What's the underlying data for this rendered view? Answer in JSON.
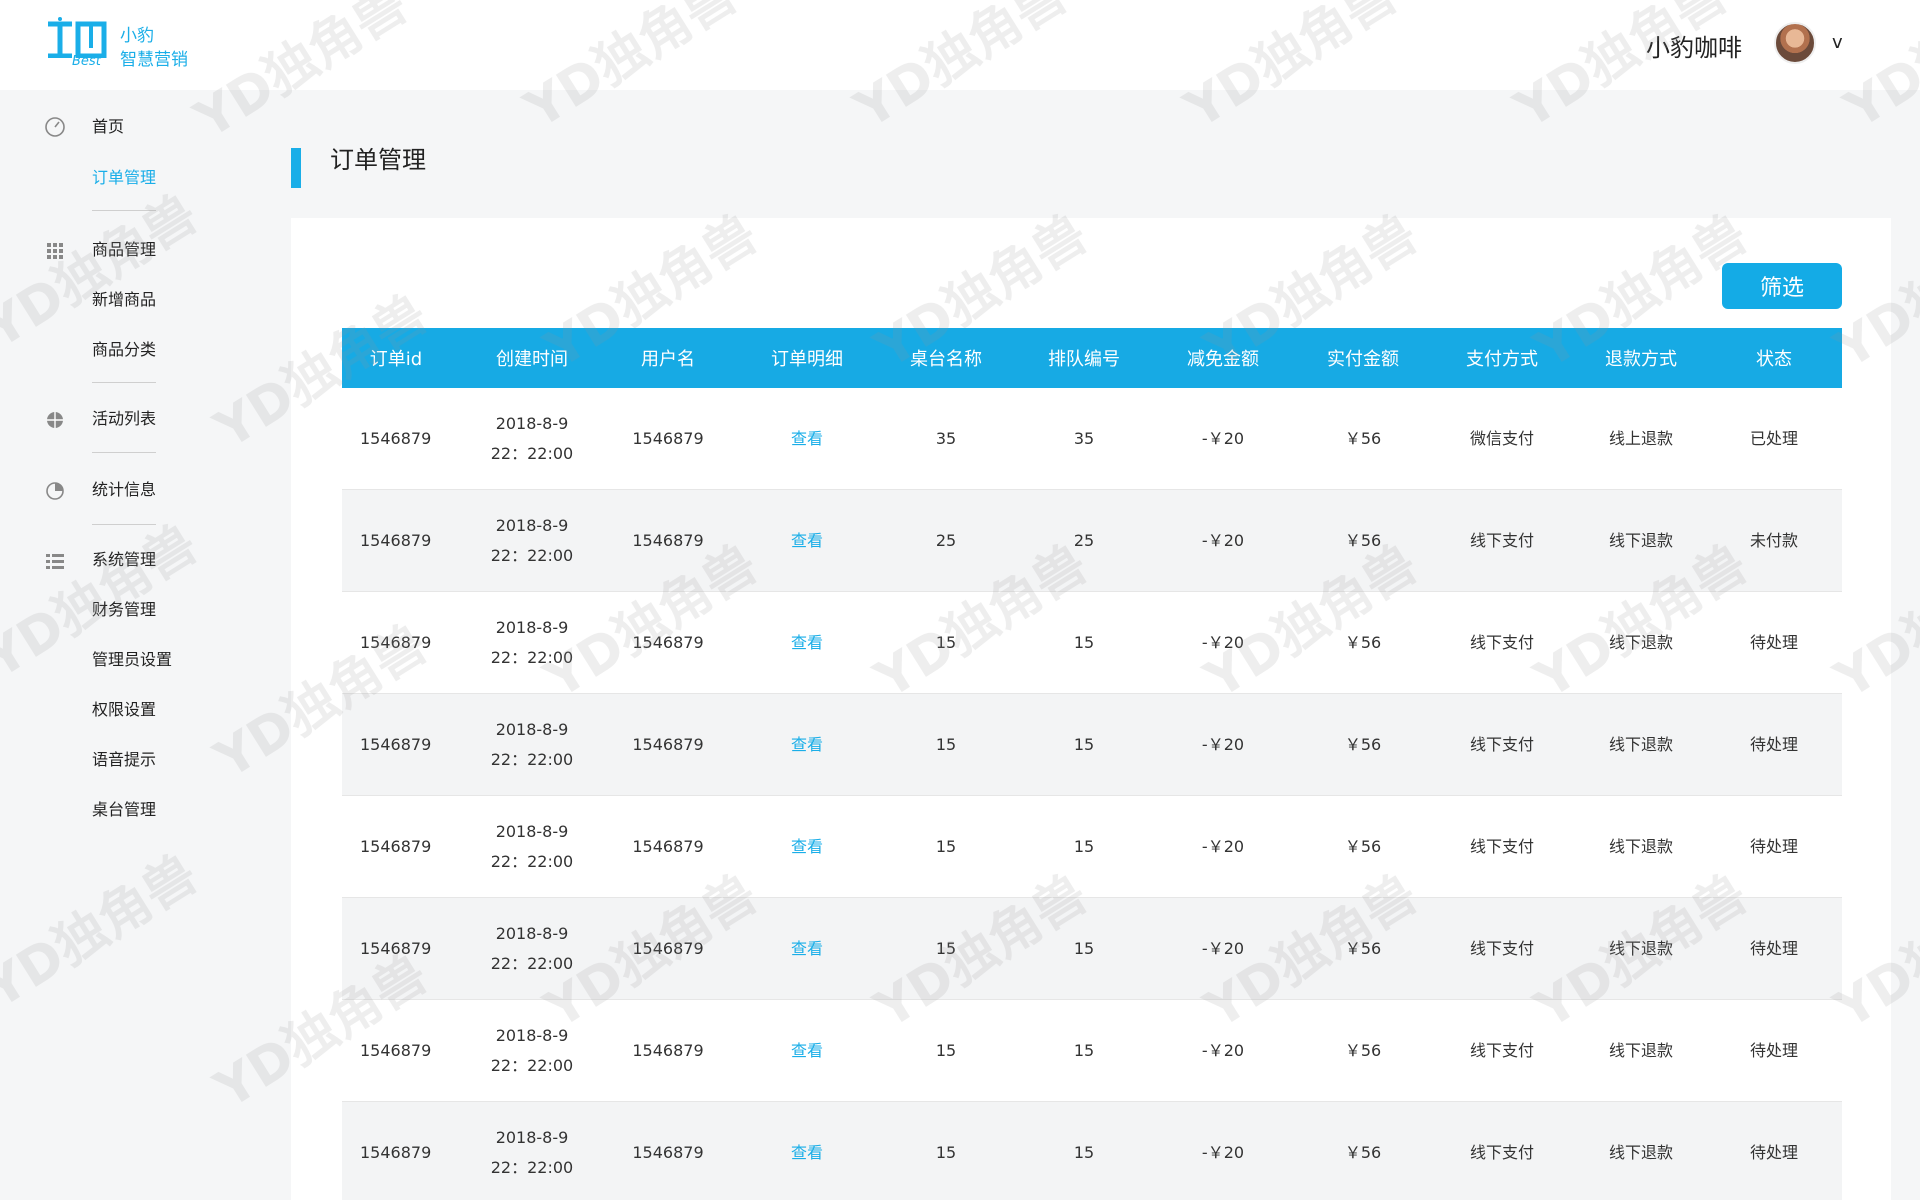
{
  "header": {
    "logo_title": "小豹",
    "logo_subtitle": "智慧营销",
    "logo_tag": "Best",
    "shop_name": "小豹咖啡",
    "dropdown_glyph": "v"
  },
  "sidebar": {
    "items": [
      {
        "label": "首页",
        "icon": "dashboard-icon"
      },
      {
        "label": "订单管理",
        "active": true
      },
      {
        "label": "商品管理",
        "icon": "grid-icon"
      },
      {
        "label": "新增商品"
      },
      {
        "label": "商品分类"
      },
      {
        "label": "活动列表",
        "icon": "globe-icon"
      },
      {
        "label": "统计信息",
        "icon": "pie-chart-icon"
      },
      {
        "label": "系统管理",
        "icon": "list-settings-icon"
      },
      {
        "label": "财务管理"
      },
      {
        "label": "管理员设置"
      },
      {
        "label": "权限设置"
      },
      {
        "label": "语音提示"
      },
      {
        "label": "桌台管理"
      }
    ]
  },
  "page": {
    "title": "订单管理",
    "filter_label": "筛选"
  },
  "table": {
    "columns": [
      "订单id",
      "创建时间",
      "用户名",
      "订单明细",
      "桌台名称",
      "排队编号",
      "减免金额",
      "实付金额",
      "支付方式",
      "退款方式",
      "状态"
    ],
    "rows": [
      {
        "id": "1546879",
        "date": "2018-8-9",
        "time": "22：22:00",
        "user": "1546879",
        "detail": "查看",
        "table": "35",
        "queue": "35",
        "discount": "-￥20",
        "paid": "￥56",
        "pay_method": "微信支付",
        "refund": "线上退款",
        "status": "已处理"
      },
      {
        "id": "1546879",
        "date": "2018-8-9",
        "time": "22：22:00",
        "user": "1546879",
        "detail": "查看",
        "table": "25",
        "queue": "25",
        "discount": "-￥20",
        "paid": "￥56",
        "pay_method": "线下支付",
        "refund": "线下退款",
        "status": "未付款"
      },
      {
        "id": "1546879",
        "date": "2018-8-9",
        "time": "22：22:00",
        "user": "1546879",
        "detail": "查看",
        "table": "15",
        "queue": "15",
        "discount": "-￥20",
        "paid": "￥56",
        "pay_method": "线下支付",
        "refund": "线下退款",
        "status": "待处理"
      },
      {
        "id": "1546879",
        "date": "2018-8-9",
        "time": "22：22:00",
        "user": "1546879",
        "detail": "查看",
        "table": "15",
        "queue": "15",
        "discount": "-￥20",
        "paid": "￥56",
        "pay_method": "线下支付",
        "refund": "线下退款",
        "status": "待处理"
      },
      {
        "id": "1546879",
        "date": "2018-8-9",
        "time": "22：22:00",
        "user": "1546879",
        "detail": "查看",
        "table": "15",
        "queue": "15",
        "discount": "-￥20",
        "paid": "￥56",
        "pay_method": "线下支付",
        "refund": "线下退款",
        "status": "待处理"
      },
      {
        "id": "1546879",
        "date": "2018-8-9",
        "time": "22：22:00",
        "user": "1546879",
        "detail": "查看",
        "table": "15",
        "queue": "15",
        "discount": "-￥20",
        "paid": "￥56",
        "pay_method": "线下支付",
        "refund": "线下退款",
        "status": "待处理"
      },
      {
        "id": "1546879",
        "date": "2018-8-9",
        "time": "22：22:00",
        "user": "1546879",
        "detail": "查看",
        "table": "15",
        "queue": "15",
        "discount": "-￥20",
        "paid": "￥56",
        "pay_method": "线下支付",
        "refund": "线下退款",
        "status": "待处理"
      },
      {
        "id": "1546879",
        "date": "2018-8-9",
        "time": "22：22:00",
        "user": "1546879",
        "detail": "查看",
        "table": "15",
        "queue": "15",
        "discount": "-￥20",
        "paid": "￥56",
        "pay_method": "线下支付",
        "refund": "线下退款",
        "status": "待处理"
      }
    ]
  },
  "watermark": "YD独角兽",
  "colors": {
    "accent": "#1aaee8",
    "header_row": "#17aae4",
    "background": "#f5f6f7"
  }
}
